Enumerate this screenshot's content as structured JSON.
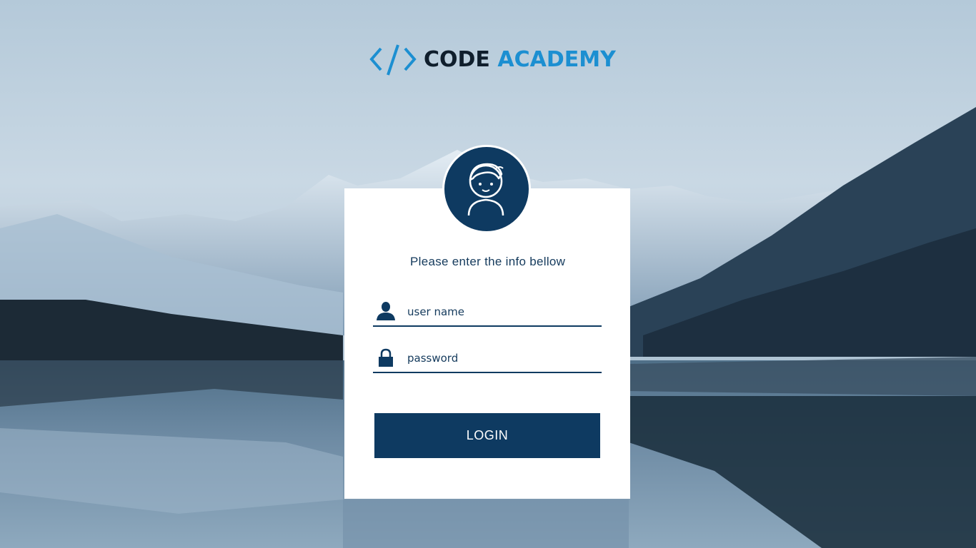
{
  "brand": {
    "code": "CODE",
    "academy": "ACADEMY",
    "logo_icon": "code-brackets-icon"
  },
  "form": {
    "prompt": "Please enter the info bellow",
    "username": {
      "placeholder": "user name",
      "value": "",
      "icon": "user-icon"
    },
    "password": {
      "placeholder": "password",
      "value": "",
      "icon": "lock-icon"
    },
    "login_label": "LOGIN"
  },
  "colors": {
    "navy": "#0e3a61",
    "brand_blue": "#1c8fd1",
    "brand_dark": "#0f1e2c",
    "card": "#ffffff"
  }
}
